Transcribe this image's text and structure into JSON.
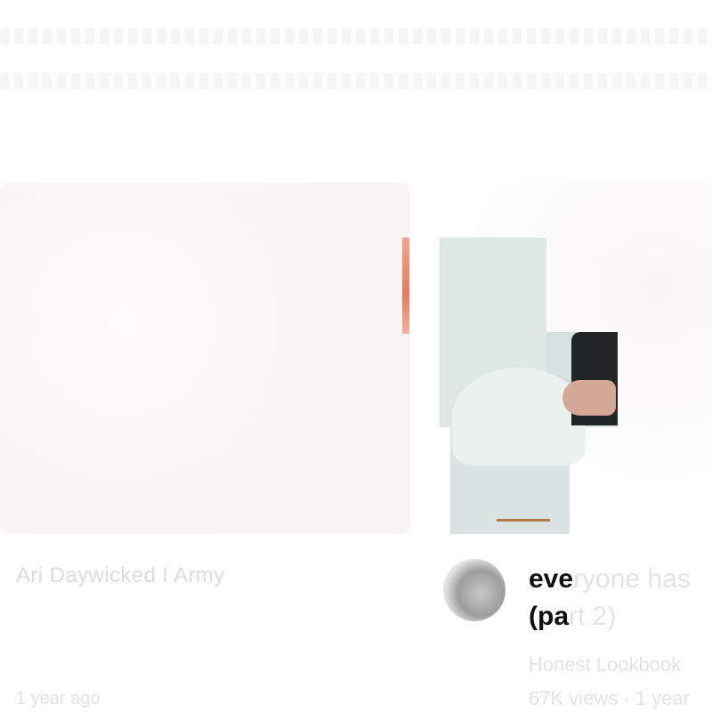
{
  "video_left": {
    "title": "Ari Daywicked I Army",
    "meta": "1 year ago"
  },
  "video_right": {
    "title_line1_visible": "eve",
    "title_line1_faded": "ryone has",
    "title_line2_visible": "(pa",
    "title_line2_faded": "rt 2)",
    "channel": "Honest Lookbook",
    "stats": "67K views · 1 year"
  },
  "colors": {
    "accent": "#e9795e",
    "title_text": "#111111",
    "faded_text": "#e3e3e3"
  }
}
